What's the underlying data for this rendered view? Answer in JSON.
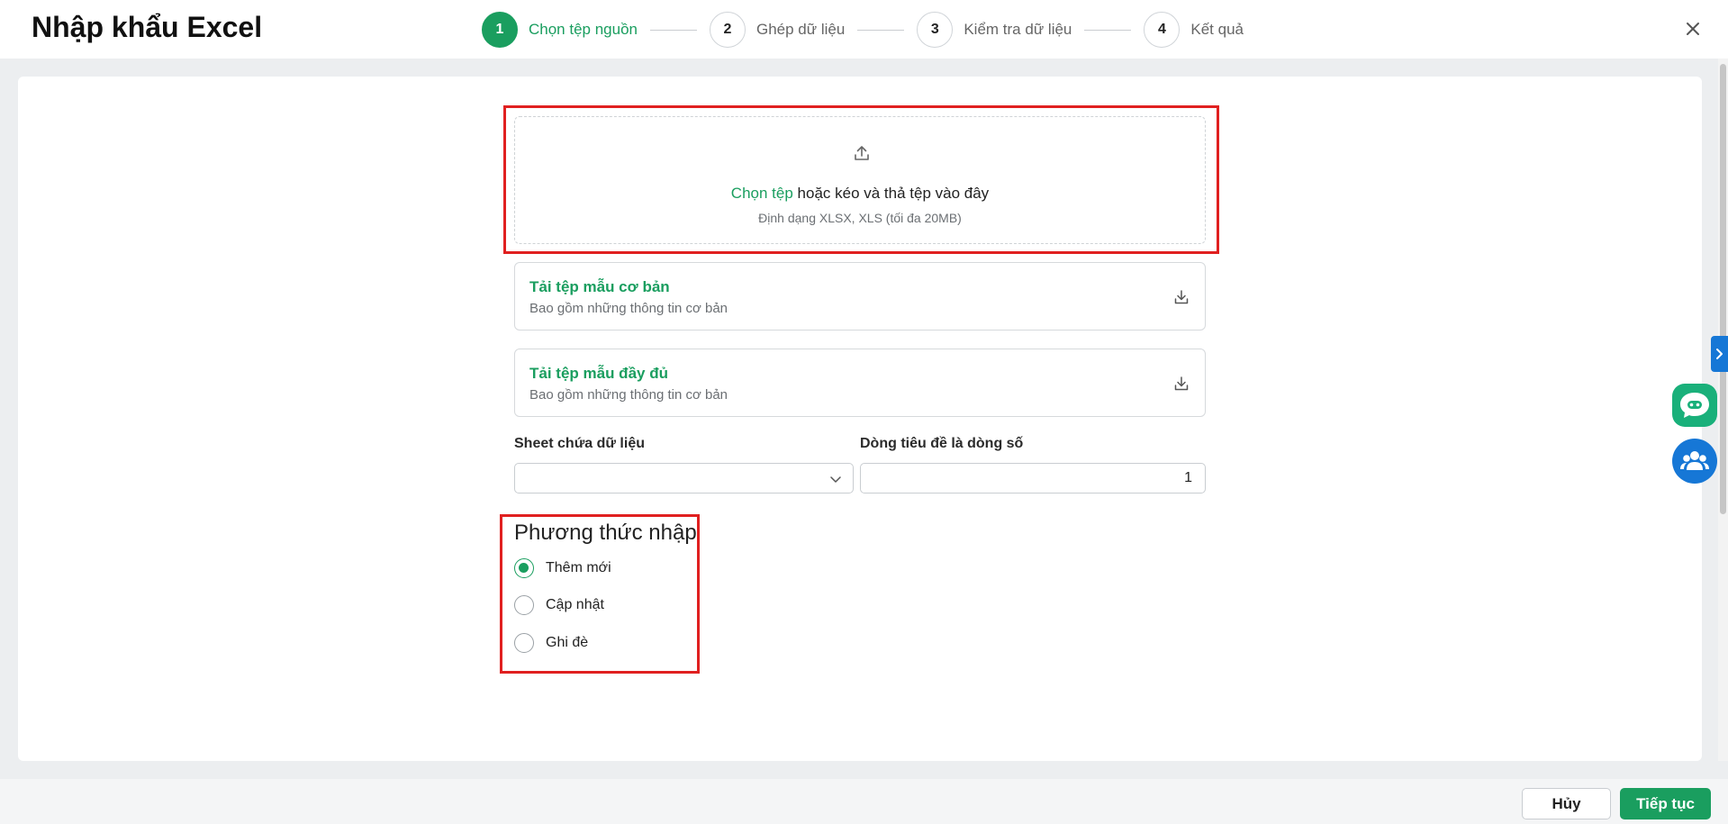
{
  "header": {
    "title": "Nhập khẩu Excel",
    "steps": [
      {
        "number": "1",
        "label": "Chọn tệp nguồn",
        "active": true
      },
      {
        "number": "2",
        "label": "Ghép dữ liệu",
        "active": false
      },
      {
        "number": "3",
        "label": "Kiểm tra dữ liệu",
        "active": false
      },
      {
        "number": "4",
        "label": "Kết quả",
        "active": false
      }
    ],
    "close_icon": "close-icon"
  },
  "upload": {
    "link_text": "Chọn tệp",
    "text": "hoặc kéo và thả tệp vào đây",
    "hint": "Định dạng XLSX, XLS (tối đa 20MB)",
    "icon": "upload-icon"
  },
  "templates": [
    {
      "title": "Tải tệp mẫu cơ bản",
      "subtitle": "Bao gồm những thông tin cơ bản",
      "icon": "download-icon"
    },
    {
      "title": "Tải tệp mẫu đầy đủ",
      "subtitle": "Bao gồm những thông tin cơ bản",
      "icon": "download-icon"
    }
  ],
  "fields": {
    "sheet_label": "Sheet chứa dữ liệu",
    "sheet_value": "",
    "header_row_label": "Dòng tiêu đề là dòng số",
    "header_row_value": "1"
  },
  "import_method": {
    "title": "Phương thức nhập",
    "options": [
      {
        "label": "Thêm mới",
        "checked": true
      },
      {
        "label": "Cập nhật",
        "checked": false
      },
      {
        "label": "Ghi đè",
        "checked": false
      }
    ]
  },
  "footer": {
    "cancel_label": "Hủy",
    "next_label": "Tiếp tục"
  },
  "colors": {
    "accent": "#1a9e5f",
    "highlight": "#e02020",
    "blue": "#1677d6"
  }
}
